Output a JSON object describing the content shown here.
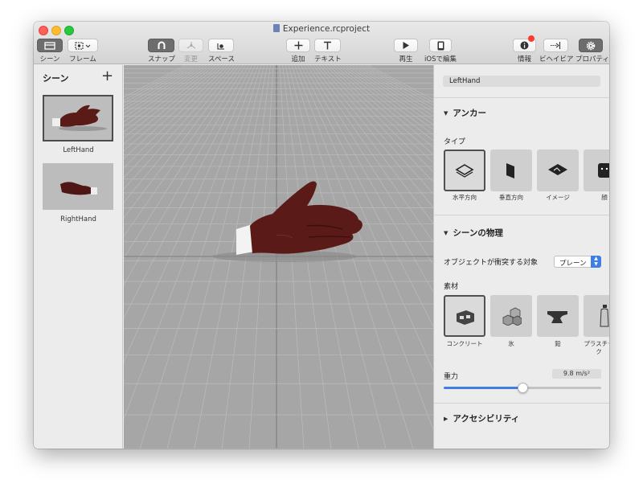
{
  "window": {
    "title": "Experience.rcproject"
  },
  "toolbar": {
    "scene": "シーン",
    "frame": "フレーム",
    "snap": "スナップ",
    "transform": "変更",
    "space": "スペース",
    "add": "追加",
    "text": "テキスト",
    "play": "再生",
    "edit_ios": "iOSで編集",
    "info": "情報",
    "behaviors": "ビヘイビア",
    "properties": "プロパティ"
  },
  "scenes": {
    "header": "シーン",
    "items": [
      {
        "label": "LeftHand",
        "selected": true
      },
      {
        "label": "RightHand",
        "selected": false
      }
    ]
  },
  "inspector": {
    "name_value": "LeftHand",
    "anchor": {
      "title": "アンカー",
      "type_label": "タイプ",
      "types": [
        "水平方向",
        "垂直方向",
        "イメージ",
        "顔"
      ],
      "selected_type": "水平方向"
    },
    "physics": {
      "title": "シーンの物理",
      "collides_label": "オブジェクトが衝突する対象",
      "collides_value": "プレーン",
      "material_label": "素材",
      "materials": [
        "コンクリート",
        "氷",
        "鉛",
        "プラスチック"
      ],
      "selected_material": "コンクリート",
      "gravity_label": "重力",
      "gravity_value": "9.8 m/s²",
      "gravity_slider_fraction": 0.5
    },
    "accessibility": {
      "title": "アクセシビリティ"
    }
  },
  "colors": {
    "accent": "#3f7fe4",
    "glove": "#5a1a18",
    "close": "#fe5f57",
    "minimize": "#febc2e",
    "zoom": "#28c840",
    "badge": "#ff3b30"
  }
}
